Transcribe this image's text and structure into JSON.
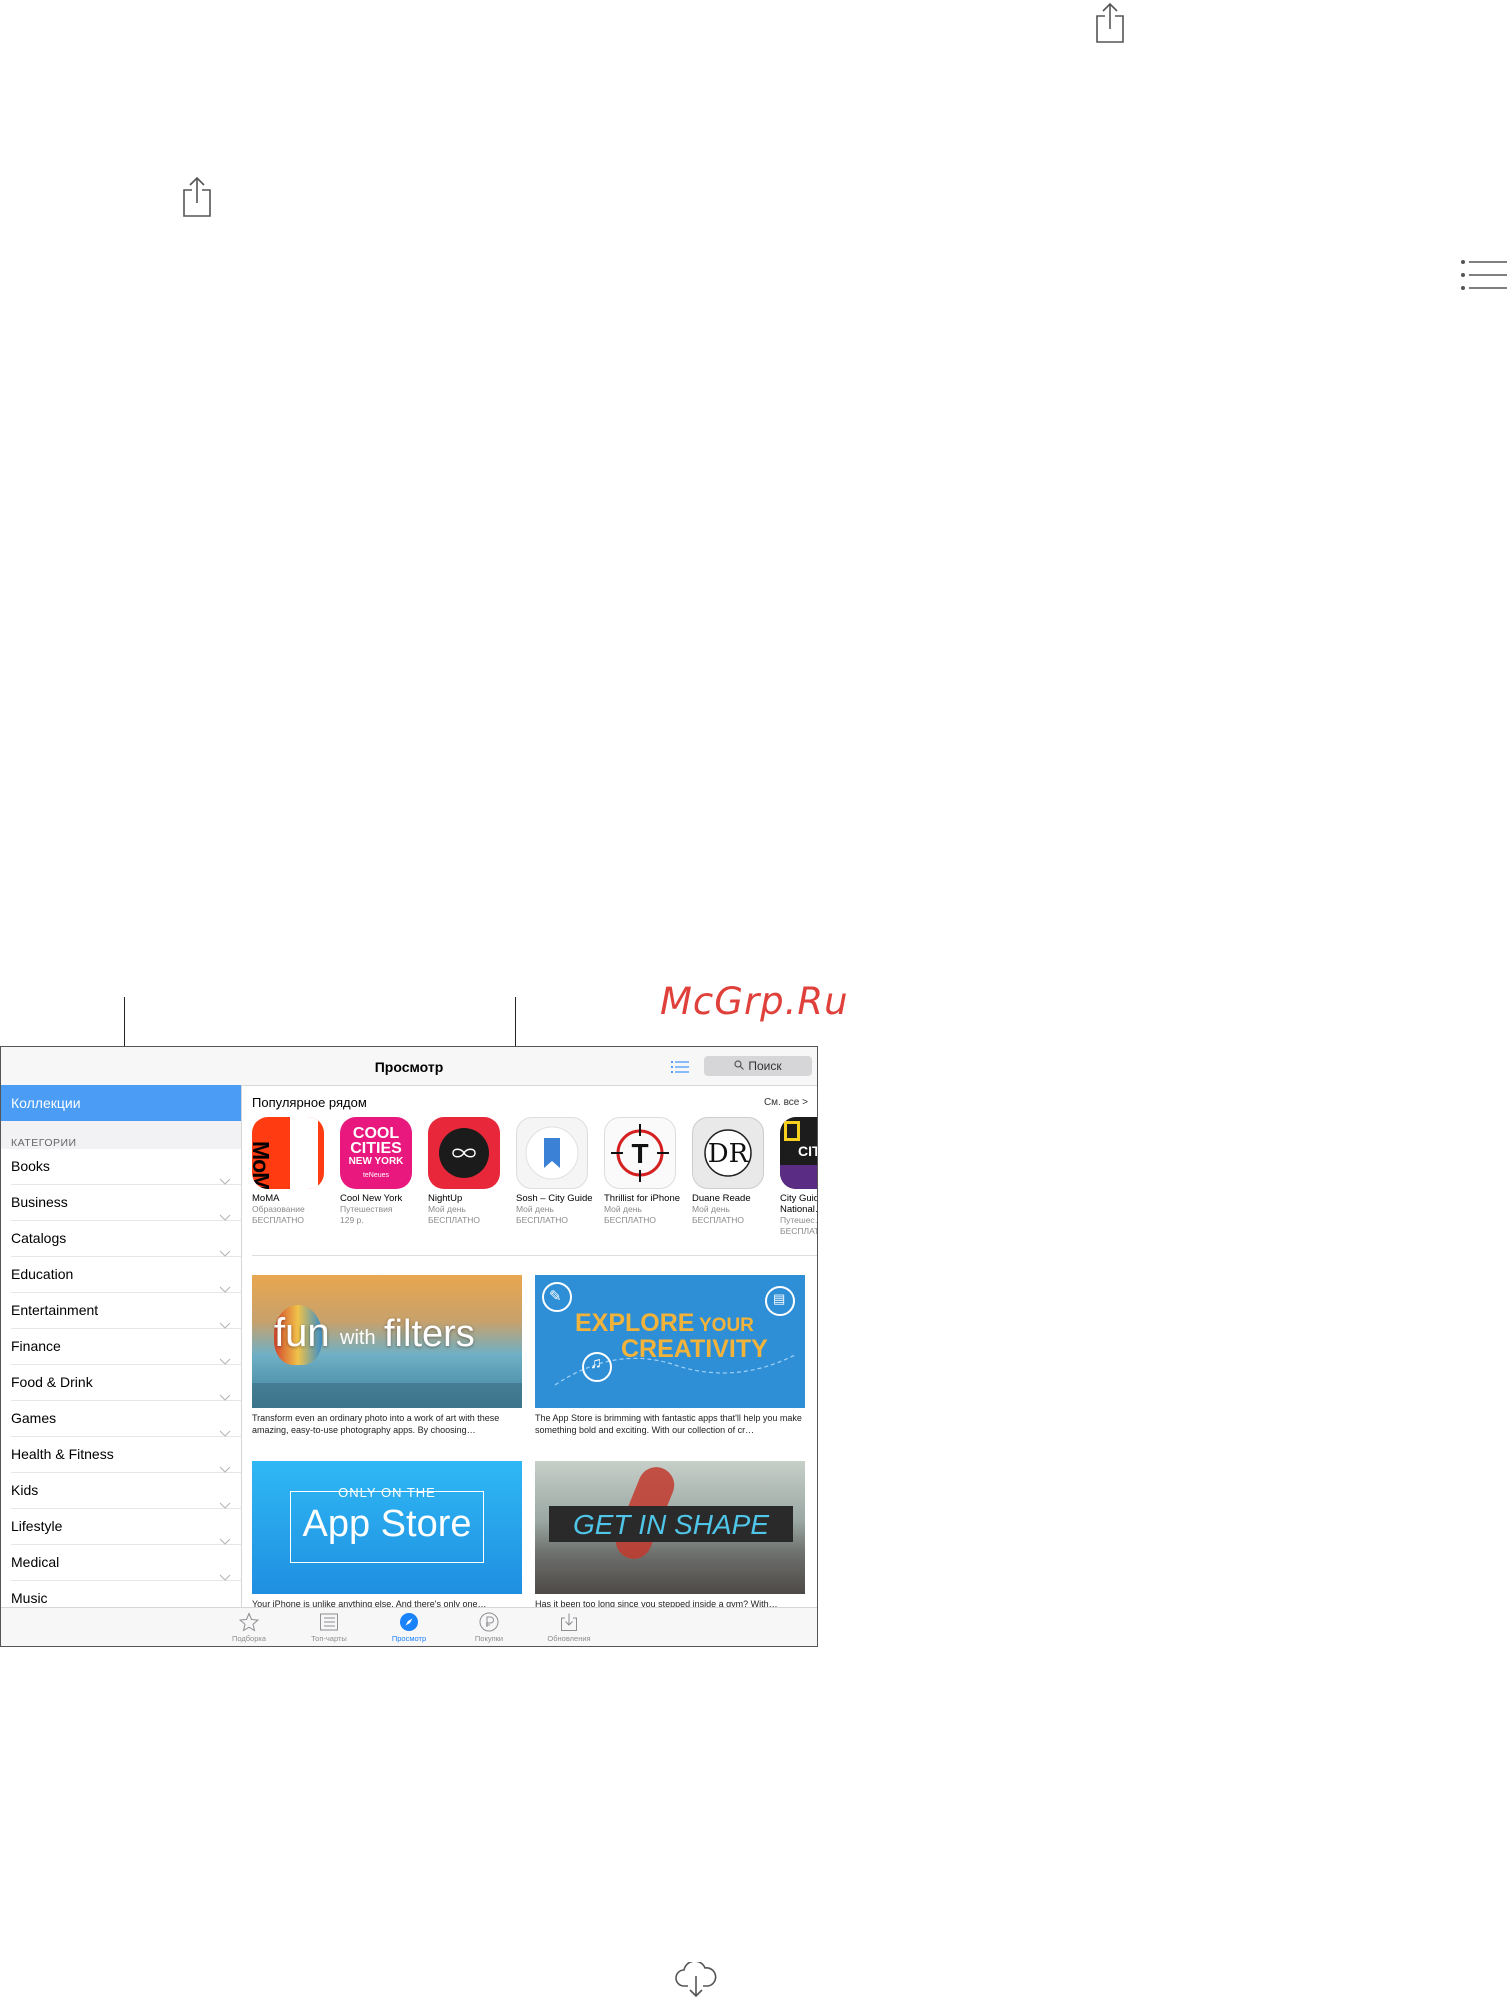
{
  "watermark": "McGrp.Ru",
  "icons": [
    "share-icon",
    "list-icon",
    "cloud-download-icon"
  ],
  "ipad": {
    "nav_title": "Просмотр",
    "search_placeholder": "Поиск",
    "sidebar": {
      "collections_label": "Коллекции",
      "categories_header": "КАТЕГОРИИ",
      "categories": [
        "Books",
        "Business",
        "Catalogs",
        "Education",
        "Entertainment",
        "Finance",
        "Food & Drink",
        "Games",
        "Health & Fitness",
        "Kids",
        "Lifestyle",
        "Medical",
        "Music"
      ]
    },
    "nearby": {
      "title": "Популярное рядом",
      "see_all": "См. все >",
      "apps": [
        {
          "name": "MoMA",
          "category": "Образование",
          "price": "БЕСПЛАТНО"
        },
        {
          "name": "Cool New York",
          "category": "Путешествия",
          "price": "129 р."
        },
        {
          "name": "NightUp",
          "category": "Мой день",
          "price": "БЕСПЛАТНО"
        },
        {
          "name": "Sosh – City Guide",
          "category": "Мой день",
          "price": "БЕСПЛАТНО"
        },
        {
          "name": "Thrillist for iPhone",
          "category": "Мой день",
          "price": "БЕСПЛАТНО"
        },
        {
          "name": "Duane Reade",
          "category": "Мой день",
          "price": "БЕСПЛАТНО"
        },
        {
          "name": "City Guides National…",
          "category": "Путешес…",
          "price": "БЕСПЛАТ…"
        }
      ],
      "icon_texts": {
        "moma": "MoMA",
        "cool_line1": "COOL",
        "cool_line2": "CITIES",
        "cool_line3": "NEW YORK",
        "cool_line4": "teNeues",
        "duane": "DR",
        "thrillist": "T",
        "natgeo": "CIT"
      }
    },
    "banners": [
      {
        "headline_a": "fun",
        "headline_b": "with",
        "headline_c": "filters",
        "caption": "Transform even an ordinary photo into a work of art with these amazing, easy-to-use photography apps. By choosing…"
      },
      {
        "headline_a": "EXPLORE",
        "headline_b": "YOUR",
        "headline_c": "CREATIVITY",
        "caption": "The App Store is brimming with fantastic apps that'll help you make something bold and exciting. With our collection of cr…"
      },
      {
        "headline_a": "ONLY ON THE",
        "headline_b": "App Store",
        "caption": "Your iPhone is unlike anything else. And there's only one…"
      },
      {
        "headline_a": "GET IN SHAPE",
        "caption": "Has it been too long since you stepped inside a gym? With…"
      }
    ],
    "tabs": [
      {
        "label": "Подборка",
        "icon": "star-icon"
      },
      {
        "label": "Топ-чарты",
        "icon": "list-icon"
      },
      {
        "label": "Просмотр",
        "icon": "compass-icon",
        "active": true
      },
      {
        "label": "Покупки",
        "icon": "purchased-icon"
      },
      {
        "label": "Обновления",
        "icon": "updates-icon"
      }
    ]
  },
  "colors": {
    "accent": "#1a82fb",
    "sidebar_selected": "#4a9cf5",
    "watermark": "#e0403a"
  }
}
